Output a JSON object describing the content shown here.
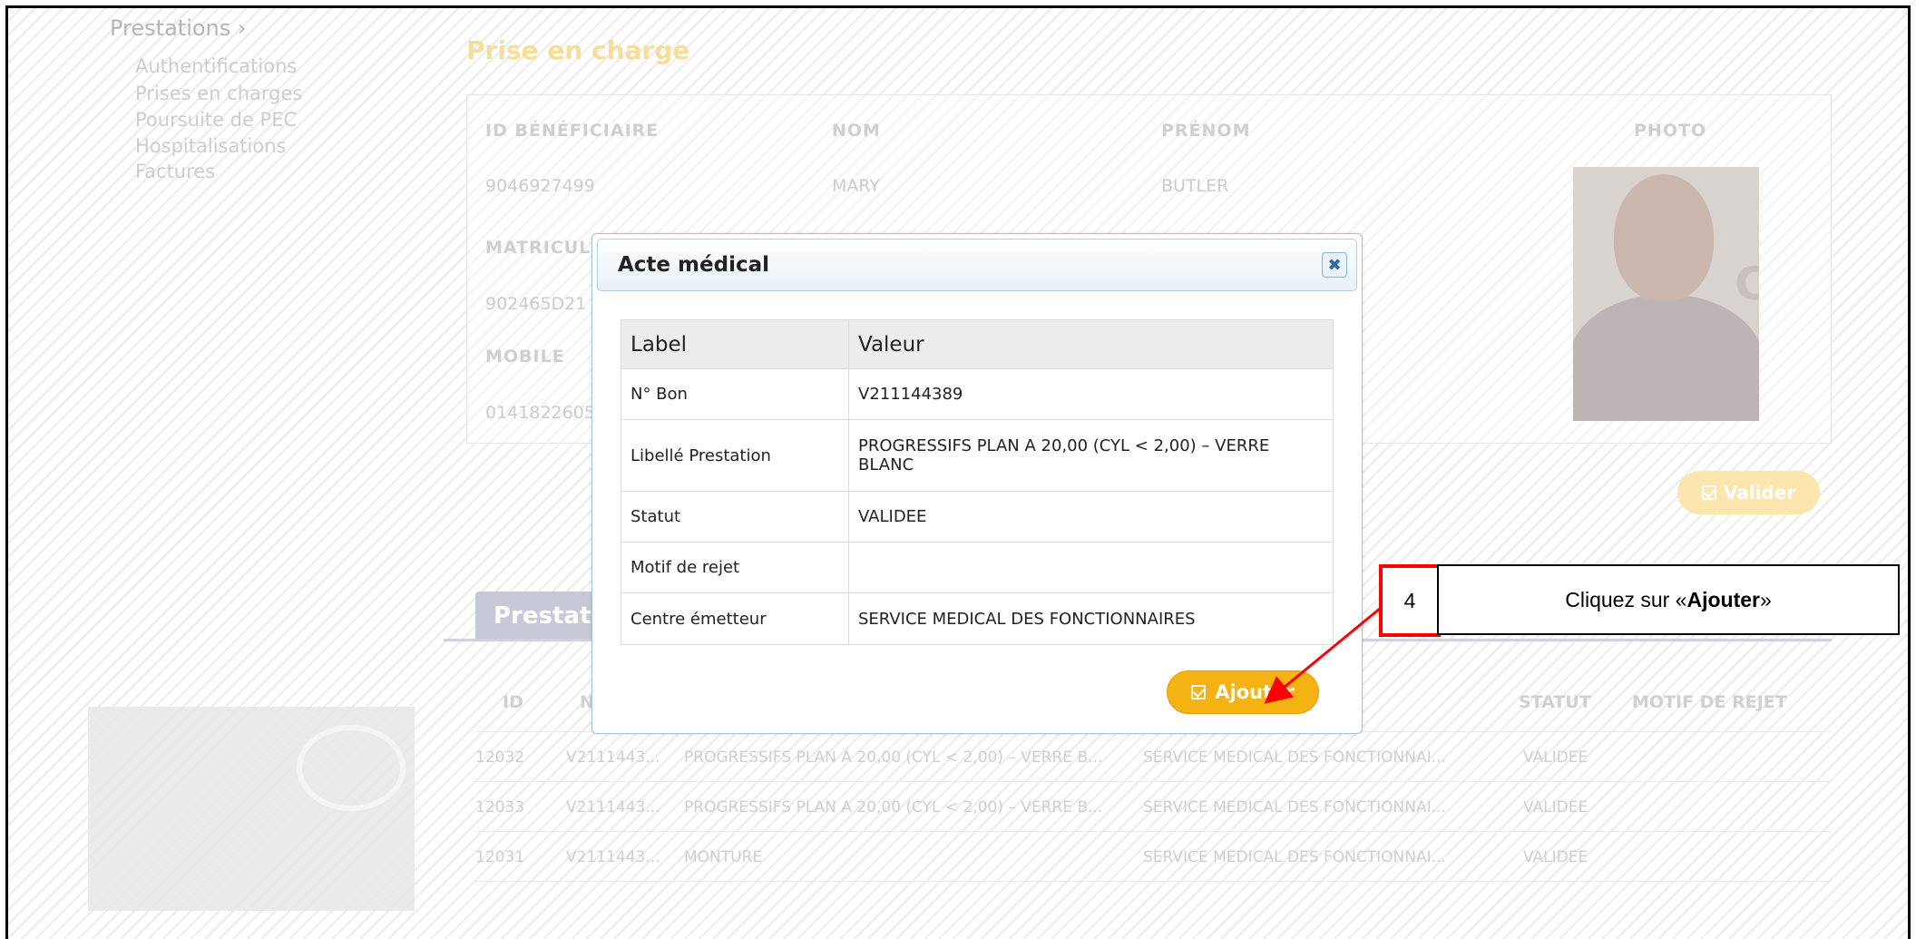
{
  "sidebar": {
    "title": "Prestations ›",
    "items": [
      "Authentifications",
      "Prises en charges",
      "Poursuite de PEC",
      "Hospitalisations",
      "Factures"
    ]
  },
  "prise_en_charge": {
    "title": "Prise en charge",
    "fields": {
      "id_label": "ID BÉNÉFICIAIRE",
      "id_value": "9046927499",
      "nom_label": "NOM",
      "nom_value": "MARY",
      "prenom_label": "PRÉNOM",
      "prenom_value": "BUTLER",
      "photo_label": "PHOTO",
      "matricule_label": "MATRICUL",
      "matricule_value": "902465D21",
      "mobile_label": "MOBILE",
      "mobile_value": "0141822605"
    },
    "valider_label": "Valider"
  },
  "prestations": {
    "tab_label": "Prestati",
    "headers": {
      "id": "ID",
      "n": "N",
      "statut": "STATUT",
      "motif": "MOTIF DE REJET"
    },
    "rows": [
      {
        "id": "12032",
        "bon": "V2111443...",
        "libelle": "PROGRESSIFS PLAN A 20,00 (CYL < 2,00) – VERRE B...",
        "centre": "SERVICE MEDICAL DES FONCTIONNAI...",
        "statut": "VALIDEE"
      },
      {
        "id": "12033",
        "bon": "V2111443...",
        "libelle": "PROGRESSIFS PLAN A 20,00 (CYL < 2,00) – VERRE B...",
        "centre": "SERVICE MEDICAL DES FONCTIONNAI...",
        "statut": "VALIDEE"
      },
      {
        "id": "12031",
        "bon": "V2111443...",
        "libelle": "MONTURE",
        "centre": "SERVICE MEDICAL DES FONCTIONNAI...",
        "statut": "VALIDEE"
      }
    ]
  },
  "modal": {
    "title": "Acte médical",
    "close_icon": "close-icon",
    "headers": {
      "label": "Label",
      "valeur": "Valeur"
    },
    "rows": [
      {
        "label": "N° Bon",
        "value": "V211144389"
      },
      {
        "label": "Libellé Prestation",
        "value": "PROGRESSIFS PLAN A 20,00 (CYL < 2,00) – VERRE BLANC"
      },
      {
        "label": "Statut",
        "value": "VALIDEE"
      },
      {
        "label": "Motif de rejet",
        "value": ""
      },
      {
        "label": "Centre émetteur",
        "value": "SERVICE MEDICAL DES FONCTIONNAIRES"
      }
    ],
    "ajouter_label": "Ajouter"
  },
  "callout": {
    "step": "4",
    "prefix": "Cliquez sur « ",
    "bold": "Ajouter",
    "suffix": " »"
  },
  "colors": {
    "accent": "#f4b313",
    "callout_red": "#ff0000"
  }
}
